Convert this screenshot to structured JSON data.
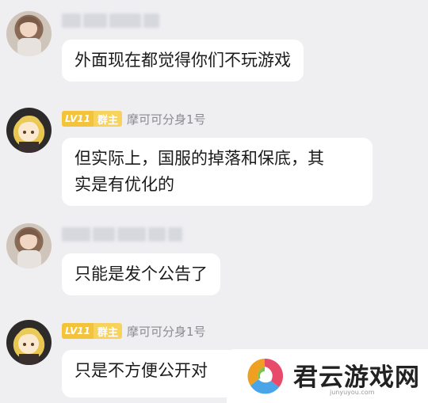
{
  "messages": [
    {
      "sender": {
        "blurred": true
      },
      "text": "外面现在都觉得你们不玩游戏"
    },
    {
      "sender": {
        "level": "LV11",
        "role": "群主",
        "nickname": "摩可可分身1号"
      },
      "lines": [
        "但实际上，国服的掉落和保底，其",
        "实是有优化的"
      ]
    },
    {
      "sender": {
        "blurred": true
      },
      "text": "只能是发个公告了"
    },
    {
      "sender": {
        "level": "LV11",
        "role": "群主",
        "nickname": "摩可可分身1号"
      },
      "text": "只是不方便公开对"
    }
  ],
  "watermark": {
    "brand": "君云游戏网",
    "url": "junyuyou.com",
    "icon": "junyun-logo-icon"
  },
  "colors": {
    "background": "#efeff2",
    "bubble": "#ffffff",
    "badge": "#f3c33b",
    "nickname": "#8a8b90"
  }
}
